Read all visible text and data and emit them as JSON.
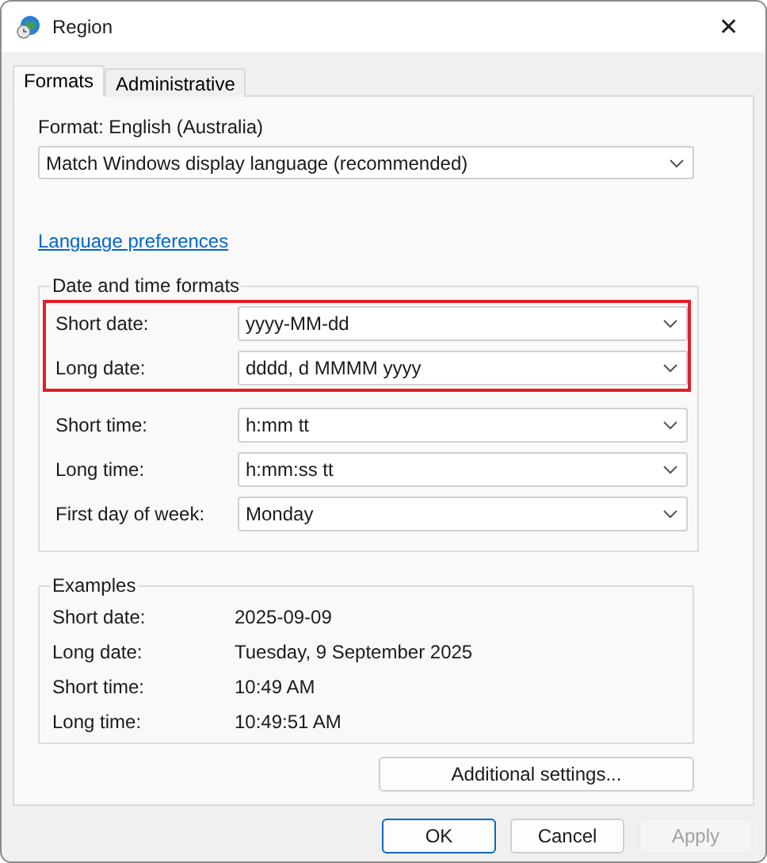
{
  "window": {
    "title": "Region",
    "close": "✕"
  },
  "tabs": [
    {
      "label": "Formats",
      "selected": true
    },
    {
      "label": "Administrative",
      "selected": false
    }
  ],
  "format": {
    "label": "Format: English (Australia)",
    "value": "Match Windows display language (recommended)"
  },
  "language_link": "Language preferences",
  "date_time_formats": {
    "title": "Date and time formats",
    "groups": [
      {
        "highlighted": true,
        "rows": [
          {
            "label": "Short date:",
            "value": "yyyy-MM-dd"
          },
          {
            "label": "Long date:",
            "value": "dddd, d MMMM yyyy"
          }
        ]
      },
      {
        "highlighted": false,
        "rows": [
          {
            "label": "Short time:",
            "value": "h:mm tt"
          },
          {
            "label": "Long time:",
            "value": "h:mm:ss tt"
          },
          {
            "label": "First day of week:",
            "value": "Monday"
          }
        ]
      }
    ]
  },
  "examples": {
    "title": "Examples",
    "rows": [
      {
        "label": "Short date:",
        "value": "2025-09-09"
      },
      {
        "label": "Long date:",
        "value": "Tuesday, 9 September 2025"
      },
      {
        "label": "Short time:",
        "value": "10:49 AM"
      },
      {
        "label": "Long time:",
        "value": "10:49:51 AM"
      }
    ]
  },
  "additional_settings": "Additional settings...",
  "buttons": [
    {
      "label": "OK",
      "default": true,
      "disabled": false
    },
    {
      "label": "Cancel",
      "default": false,
      "disabled": false
    },
    {
      "label": "Apply",
      "default": false,
      "disabled": true
    }
  ]
}
